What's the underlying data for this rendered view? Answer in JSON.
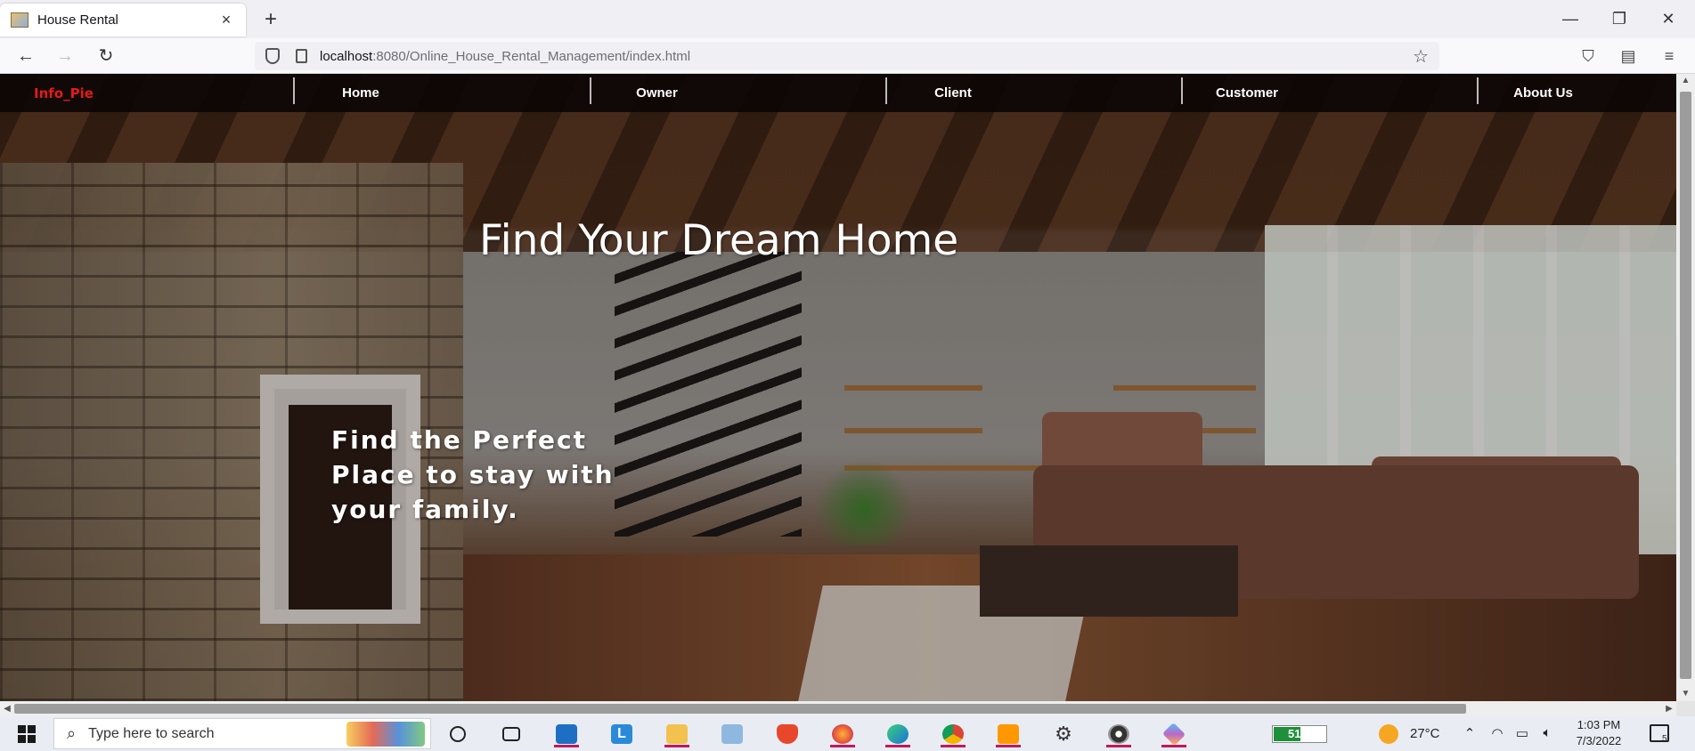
{
  "browser": {
    "tab_title": "House Rental",
    "tab_close": "×",
    "new_tab": "+",
    "window_controls": {
      "minimize": "—",
      "restore": "❐",
      "close": "✕"
    },
    "nav": {
      "back": "←",
      "forward": "→",
      "reload": "↻"
    },
    "url_host": "localhost",
    "url_path": ":8080/Online_House_Rental_Management/index.html",
    "bookmark_icon": "☆",
    "toolbar_icons": [
      "pocket-icon",
      "extensions-icon",
      "menu-icon"
    ]
  },
  "site": {
    "logo": "Info_Pie",
    "nav_links": [
      "Home",
      "Owner",
      "Client",
      "Customer",
      "About Us"
    ],
    "hero_title": "Find Your Dream Home",
    "hero_subtitle_lines": [
      "Find the Perfect",
      "Place to stay with",
      "your family."
    ]
  },
  "colors": {
    "logo": "#e31b1b",
    "header_bg": "#0a0505",
    "hero_text": "#ffffff"
  },
  "taskbar": {
    "search_placeholder": "Type here to search",
    "apps": [
      "task-view-icon",
      "mail-icon",
      "l-app-icon",
      "file-explorer-icon",
      "monitor-icon",
      "brave-icon",
      "firefox-icon",
      "edge-icon",
      "chrome-icon",
      "sublime-text-icon",
      "settings-icon",
      "media-player-icon",
      "3d-viewer-icon"
    ],
    "battery_percent": "51%",
    "battery_level": 0.51,
    "temperature": "27°C",
    "time": "1:03 PM",
    "date": "7/3/2022",
    "notification_count": "5"
  }
}
